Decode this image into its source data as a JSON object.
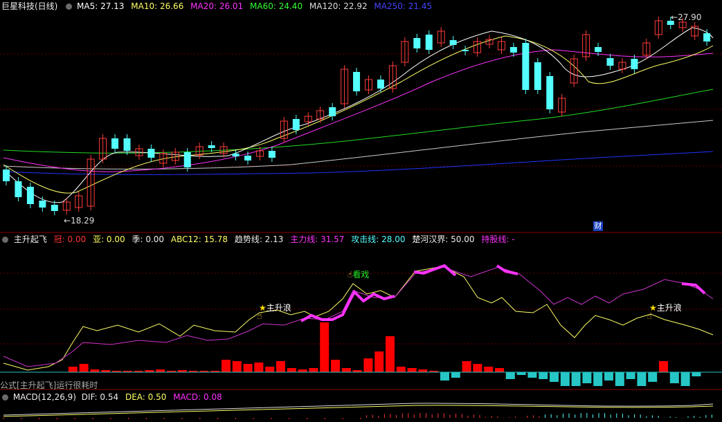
{
  "colors": {
    "bg": "#000000",
    "up": "#ff3b3b",
    "down": "#54ffff",
    "ma5": "#ffffff",
    "ma10": "#ffff66",
    "ma20": "#ff33ff",
    "ma60": "#22dd22",
    "ma120": "#cccccc",
    "ma250": "#3333ff",
    "grid": "#7a0000"
  },
  "header": {
    "title": "巨星科技(日线)",
    "ma5": "MA5: 27.13",
    "ma10": "MA10: 26.66",
    "ma20": "MA20: 26.01",
    "ma60": "MA60: 24.40",
    "ma120": "MA120: 22.92",
    "ma250": "MA250: 21.45"
  },
  "main_chart": {
    "high_label": "27.90",
    "low_label": "18.29",
    "finance_icon": "财"
  },
  "indicator": {
    "name": "主升起飞",
    "guan": "冠: 0.00",
    "ya": "亚: 0.00",
    "ji": "季: 0.00",
    "abc12": "ABC12: 15.78",
    "qushi": "趋势线: 2.13",
    "zhuli": "主力线: 31.57",
    "gongji": "攻击线: 28.00",
    "chuhe": "楚河汉界: 50.00",
    "chigu": "持股线: -",
    "signal1": "主升浪",
    "signal2": "看戏",
    "signal3": "主升浪",
    "footer_note": "公式[主升起飞]运行很耗时"
  },
  "macd": {
    "name": "MACD(12,26,9)",
    "dif": "DIF: 0.54",
    "dea": "DEA: 0.50",
    "macd": "MACD: 0.08"
  },
  "icons": [
    "settings-circle-icon",
    "star-icon",
    "hand-pointer-icon"
  ]
}
